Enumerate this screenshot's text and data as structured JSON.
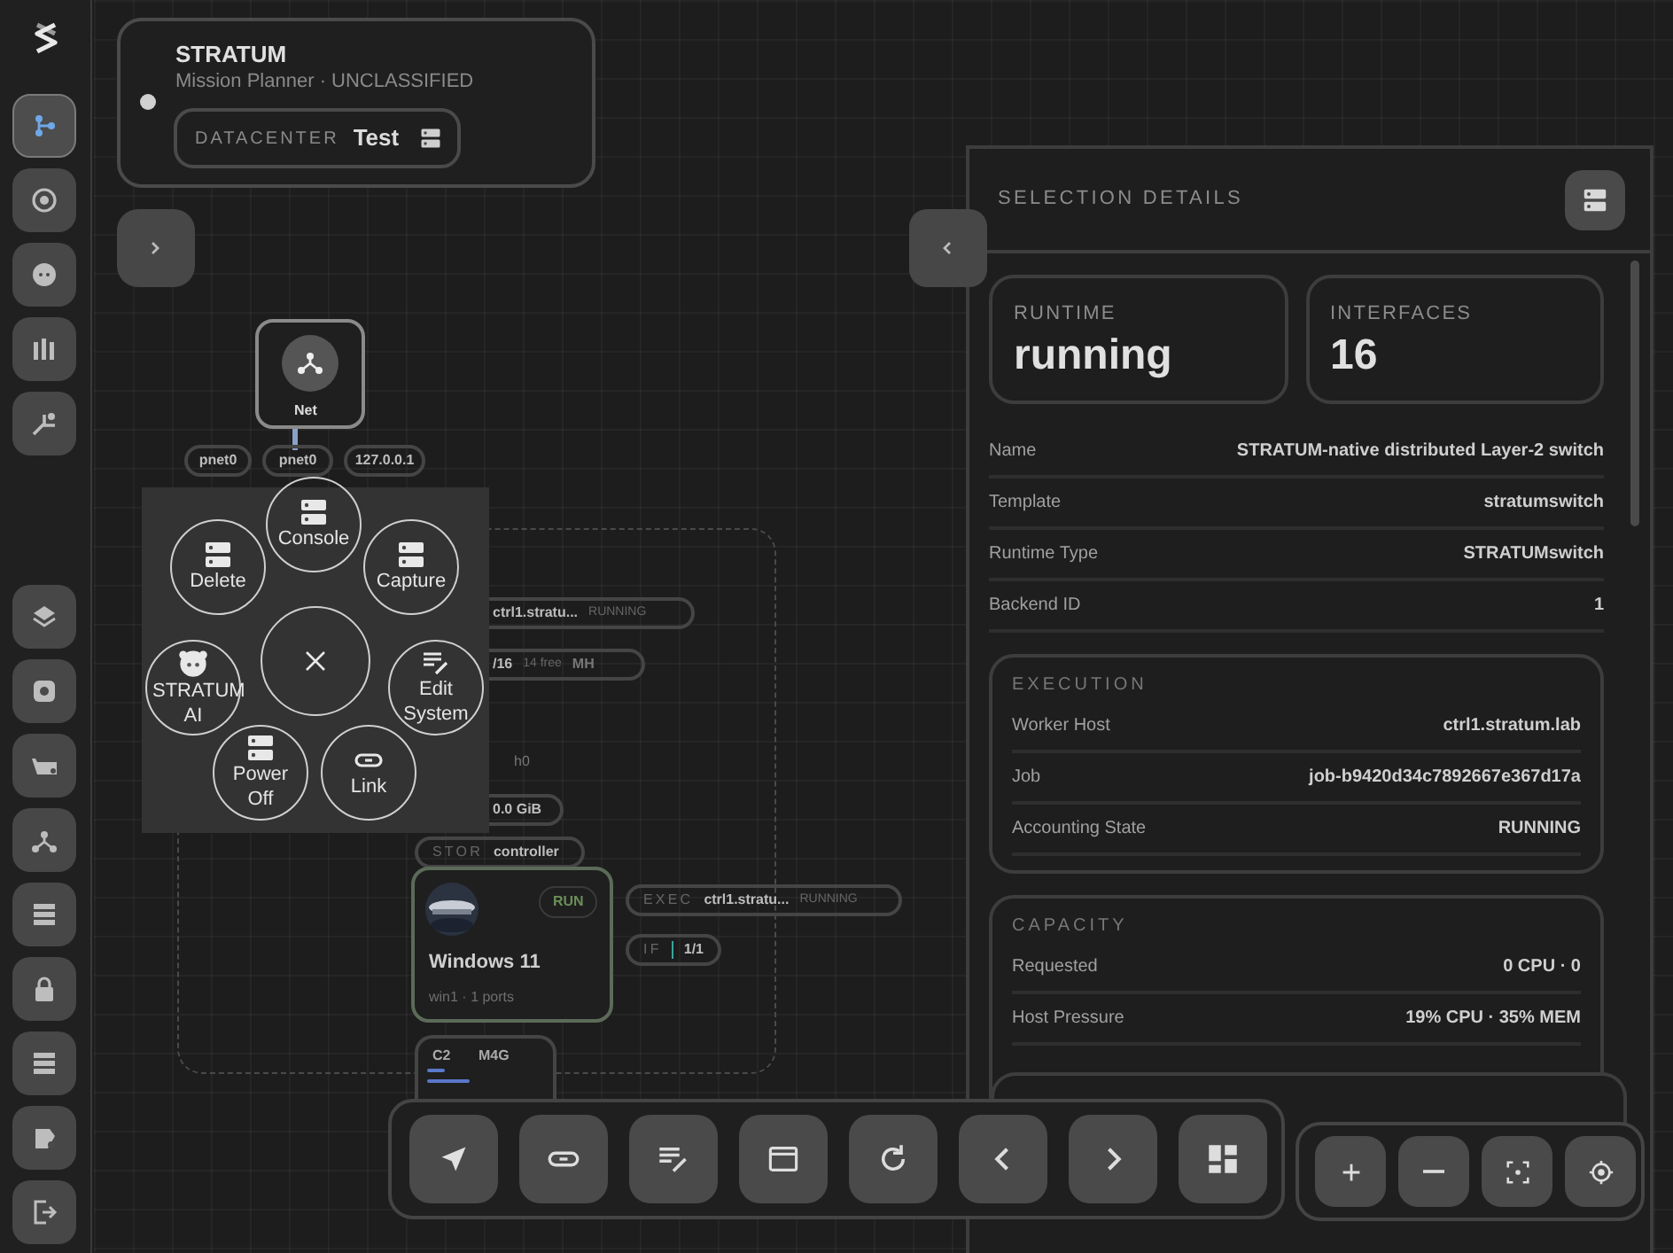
{
  "sidebar": {
    "top_items": [
      {
        "selected": true
      },
      {
        "selected": false
      },
      {
        "selected": false
      },
      {
        "selected": false
      },
      {
        "selected": false
      }
    ],
    "bottom_items": [
      {
        "selected": false
      },
      {
        "selected": false
      },
      {
        "selected": false
      },
      {
        "selected": false
      },
      {
        "selected": false
      },
      {
        "selected": false
      },
      {
        "selected": false
      },
      {
        "selected": false
      },
      {
        "selected": false
      }
    ]
  },
  "header": {
    "title": "STRATUM",
    "subtitle": "Mission Planner · UNCLASSIFIED",
    "datacenter_label": "DATACENTER",
    "datacenter_value": "Test"
  },
  "canvas": {
    "net_node": {
      "label": "Net"
    },
    "chips": [
      {
        "value": "pnet0"
      },
      {
        "value": "pnet0"
      },
      {
        "value": "127.0.0.1"
      },
      {
        "value": "ctrl1.stratu...",
        "status": "RUNNING"
      },
      {
        "value": "/16",
        "status": "14 free",
        "extra": "MH"
      },
      {
        "status": "h0"
      },
      {
        "value": "0.0 GiB"
      },
      {
        "label": "STOR",
        "value": "controller"
      },
      {
        "label": "EXEC",
        "value": "ctrl1.stratu...",
        "status": "RUNNING"
      },
      {
        "label": "IF",
        "value": "1/1"
      }
    ],
    "vm_card": {
      "badge": "RUN",
      "title": "Windows 11",
      "subtitle": "win1 · 1 ports"
    },
    "resource_card": {
      "cpu": "C2",
      "mem": "M4G"
    }
  },
  "radial_menu": {
    "items": [
      {
        "label": "Console",
        "kind": "server"
      },
      {
        "label": "Delete",
        "kind": "server"
      },
      {
        "label": "Capture",
        "kind": "server"
      },
      {
        "label": "STRATUM AI",
        "kind": "bot"
      },
      {
        "label": "Edit System",
        "kind": "edit"
      },
      {
        "label": "Power Off",
        "kind": "server"
      },
      {
        "label": "Link",
        "kind": "link"
      }
    ]
  },
  "details": {
    "title": "SELECTION DETAILS",
    "stats": [
      {
        "label": "RUNTIME",
        "value": "running"
      },
      {
        "label": "INTERFACES",
        "value": "16"
      }
    ],
    "rows": [
      {
        "label": "Name",
        "value": "STRATUM-native distributed Layer-2 switch"
      },
      {
        "label": "Template",
        "value": "stratumswitch"
      },
      {
        "label": "Runtime Type",
        "value": "STRATUMswitch"
      },
      {
        "label": "Backend ID",
        "value": "1"
      }
    ],
    "sections": [
      {
        "title": "EXECUTION",
        "rows": [
          {
            "label": "Worker Host",
            "value": "ctrl1.stratum.lab"
          },
          {
            "label": "Job",
            "value": "job-b9420d34c7892667e367d17a"
          },
          {
            "label": "Accounting State",
            "value": "RUNNING"
          }
        ]
      },
      {
        "title": "CAPACITY",
        "rows": [
          {
            "label": "Requested",
            "value": "0 CPU · 0"
          },
          {
            "label": "Host Pressure",
            "value": "19% CPU · 35% MEM"
          }
        ]
      }
    ]
  }
}
